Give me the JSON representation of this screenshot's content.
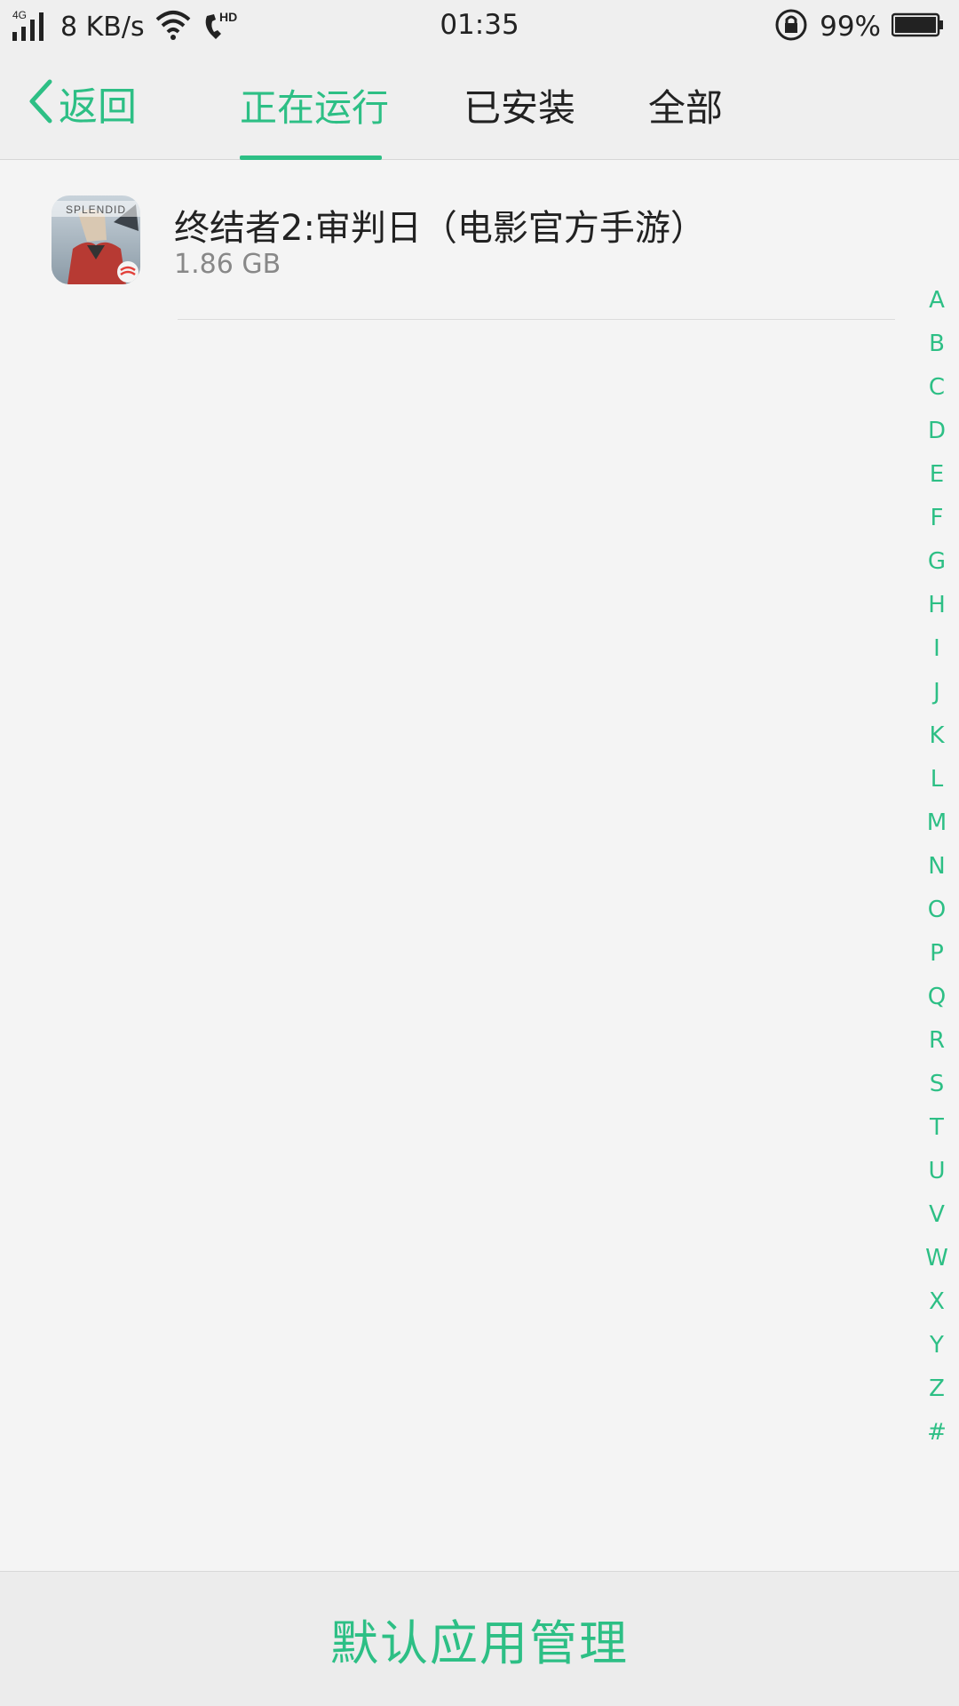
{
  "status_bar": {
    "network_type": "4G",
    "speed": "8 KB/s",
    "time": "01:35",
    "battery": "99%",
    "icons": [
      "signal-icon",
      "wifi-icon",
      "volte-hd-icon",
      "rotation-lock-icon",
      "battery-icon"
    ]
  },
  "header": {
    "back_label": "返回",
    "tabs": [
      {
        "label": "正在运行",
        "active": true
      },
      {
        "label": "已安装",
        "active": false
      },
      {
        "label": "全部",
        "active": false
      }
    ]
  },
  "apps": [
    {
      "name": "终结者2:审判日（电影官方手游）",
      "size": "1.86 GB",
      "icon_text": "SPLENDID"
    }
  ],
  "alpha_index": [
    "A",
    "B",
    "C",
    "D",
    "E",
    "F",
    "G",
    "H",
    "I",
    "J",
    "K",
    "L",
    "M",
    "N",
    "O",
    "P",
    "Q",
    "R",
    "S",
    "T",
    "U",
    "V",
    "W",
    "X",
    "Y",
    "Z",
    "#"
  ],
  "footer": {
    "label": "默认应用管理"
  },
  "colors": {
    "accent": "#2dbf85",
    "background": "#f4f4f4",
    "header": "#efefef"
  }
}
